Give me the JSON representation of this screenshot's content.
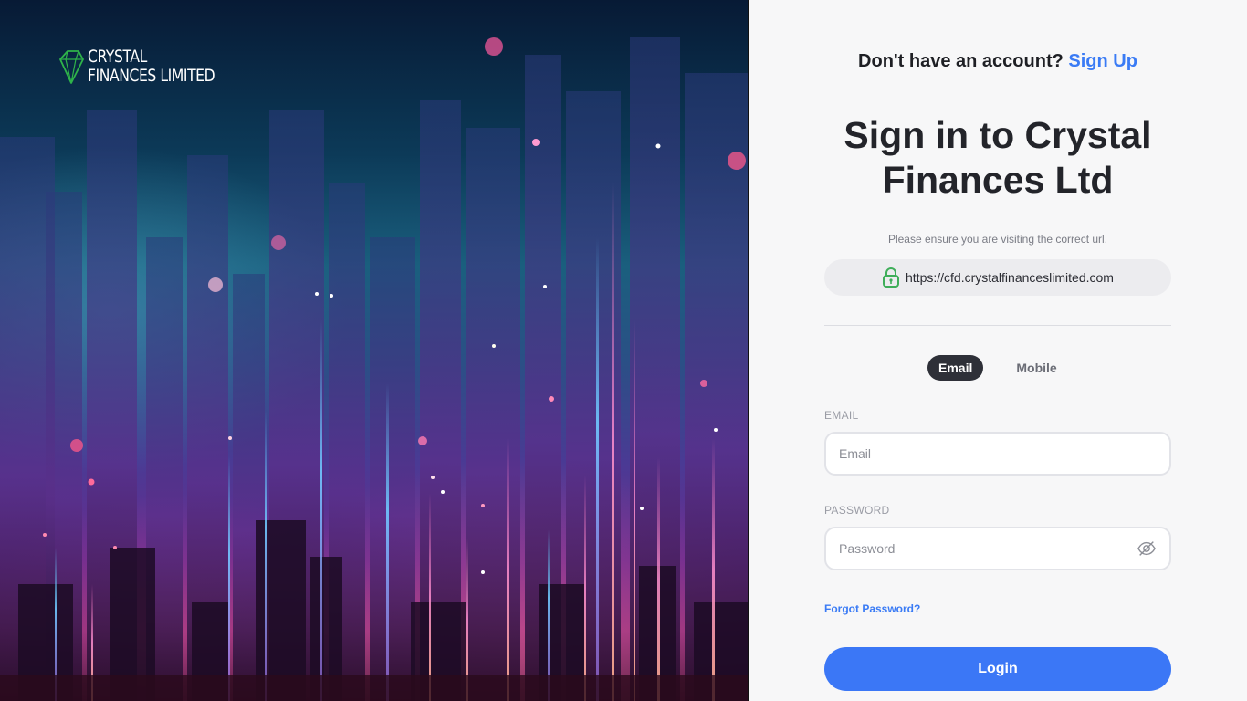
{
  "brand": {
    "logo_line1": "CRYSTAL",
    "logo_line2": "FINANCES LIMITED"
  },
  "header": {
    "signup_prompt": "Don't have an account?",
    "signup_link": "Sign Up"
  },
  "main": {
    "title": "Sign in to Crystal Finances Ltd",
    "notice": "Please ensure you are visiting the correct url.",
    "url": "https://cfd.crystalfinanceslimited.com"
  },
  "tabs": [
    {
      "label": "Email",
      "active": true
    },
    {
      "label": "Mobile",
      "active": false
    }
  ],
  "form": {
    "email_label": "EMAIL",
    "email_placeholder": "Email",
    "email_value": "",
    "password_label": "PASSWORD",
    "password_placeholder": "Password",
    "password_value": "",
    "forgot_link": "Forgot Password?",
    "login_button": "Login"
  },
  "icons": {
    "logo": "crystal-gem-icon",
    "url_secure": "lock-icon",
    "password_toggle": "eye-slash-icon"
  },
  "colors": {
    "accent": "#3b77f6",
    "link": "#3a7bf5",
    "tab_active_bg": "#2e3038",
    "lock_green": "#3fae5a",
    "logo_green": "#2fb34a"
  }
}
